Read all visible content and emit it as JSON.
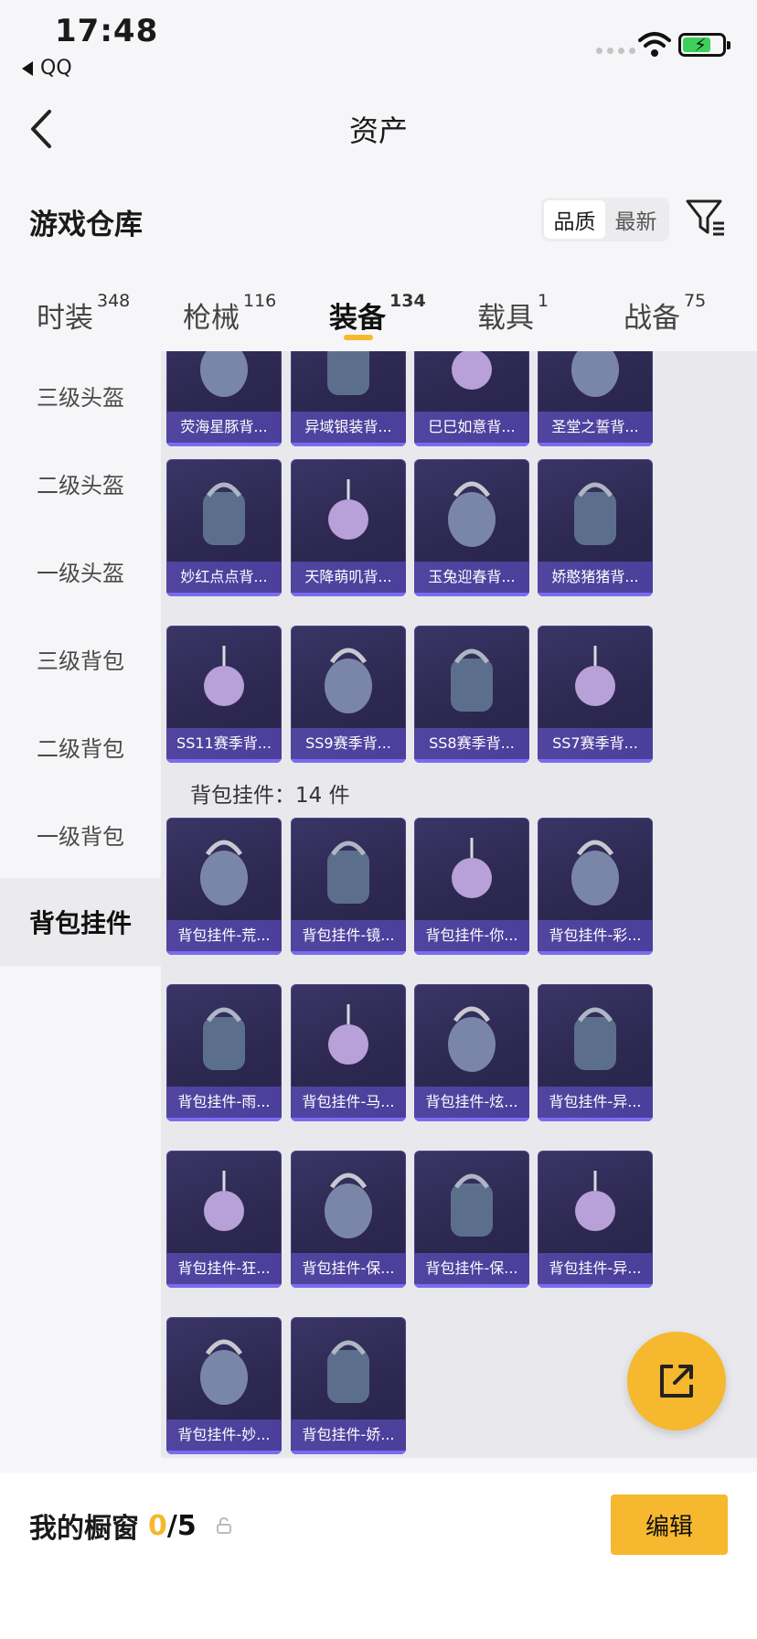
{
  "status": {
    "time": "17:48",
    "back_app": "QQ"
  },
  "nav": {
    "title": "资产"
  },
  "warehouse": {
    "title": "游戏仓库",
    "sort_options": [
      "品质",
      "最新"
    ],
    "sort_selected": "品质"
  },
  "tabs": [
    {
      "label": "时装",
      "count": "348"
    },
    {
      "label": "枪械",
      "count": "116"
    },
    {
      "label": "装备",
      "count": "134",
      "active": true
    },
    {
      "label": "载具",
      "count": "1"
    },
    {
      "label": "战备",
      "count": "75"
    }
  ],
  "sidebar": [
    {
      "label": "三级头盔"
    },
    {
      "label": "二级头盔"
    },
    {
      "label": "一级头盔"
    },
    {
      "label": "三级背包"
    },
    {
      "label": "二级背包"
    },
    {
      "label": "一级背包"
    },
    {
      "label": "背包挂件",
      "active": true
    }
  ],
  "backpacks": [
    [
      "荧海星豚背...",
      "异域银装背...",
      "巳巳如意背...",
      "圣堂之誓背..."
    ],
    [
      "妙红点点背...",
      "天降萌叽背...",
      "玉兔迎春背...",
      "娇憨猪猪背..."
    ],
    [
      "SS11赛季背...",
      "SS9赛季背...",
      "SS8赛季背...",
      "SS7赛季背..."
    ]
  ],
  "pendant_section": {
    "label": "背包挂件：14 件"
  },
  "pendants": [
    [
      "背包挂件-荒...",
      "背包挂件-镜...",
      "背包挂件-你...",
      "背包挂件-彩..."
    ],
    [
      "背包挂件-雨...",
      "背包挂件-马...",
      "背包挂件-炫...",
      "背包挂件-异..."
    ],
    [
      "背包挂件-狂...",
      "背包挂件-保...",
      "背包挂件-保...",
      "背包挂件-异..."
    ],
    [
      "背包挂件-妙...",
      "背包挂件-娇..."
    ]
  ],
  "showcase": {
    "title": "我的橱窗",
    "count": "0",
    "total": "/5",
    "edit_label": "编辑"
  },
  "colors": {
    "accent": "#f5b82e",
    "card_bg": "#2c2850",
    "card_label": "#4c3f9b"
  }
}
